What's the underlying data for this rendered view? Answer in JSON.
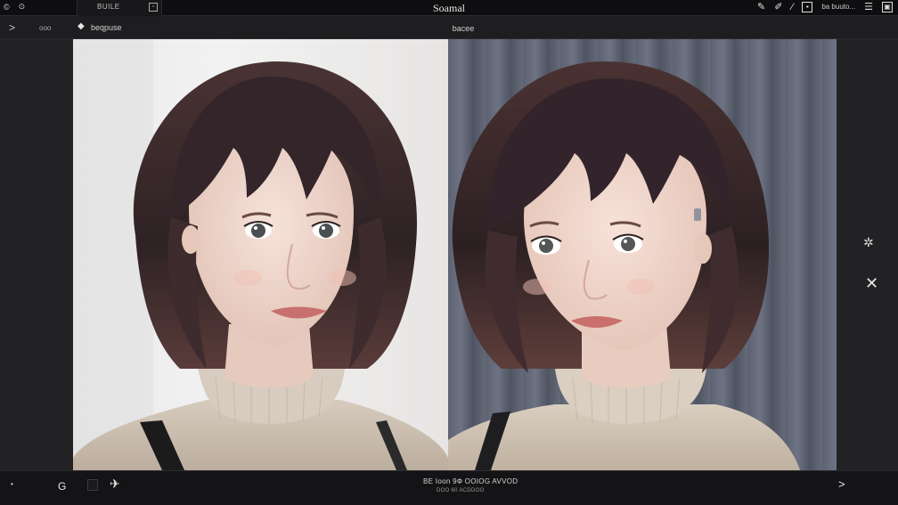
{
  "titlebar": {
    "left_icons": [
      "app-icon",
      "refresh-icon"
    ],
    "tab_label": "BUILE",
    "tab_icon": "square-icon",
    "title": "Soamal",
    "right": {
      "doc_label": "ba buuto...",
      "icons": [
        "pen-icon",
        "link-icon",
        "brush-icon",
        "image-icon",
        "menu-icon",
        "window-icon"
      ]
    }
  },
  "subbar": {
    "expand_icon": "chevron-right-icon",
    "button_label": "ooo",
    "item_label": "beqpuse",
    "center_label": "bacee"
  },
  "right_panel": {
    "icons": [
      "gear-icon",
      "close-icon"
    ]
  },
  "bottombar": {
    "left_dot": "•",
    "g_label": "G",
    "info_line1": "BE Ioon 9Ф OOIOG  AVVOD",
    "info_line2": "DOO 60 ACDDOO",
    "next_icon": "chevron-right-icon"
  },
  "colors": {
    "panel_bg": "#222225",
    "titlebar_bg": "#0e0e10",
    "hair": "#3d2a2b",
    "sweater": "#cfc4b6",
    "skin": "#f1d9cf"
  }
}
